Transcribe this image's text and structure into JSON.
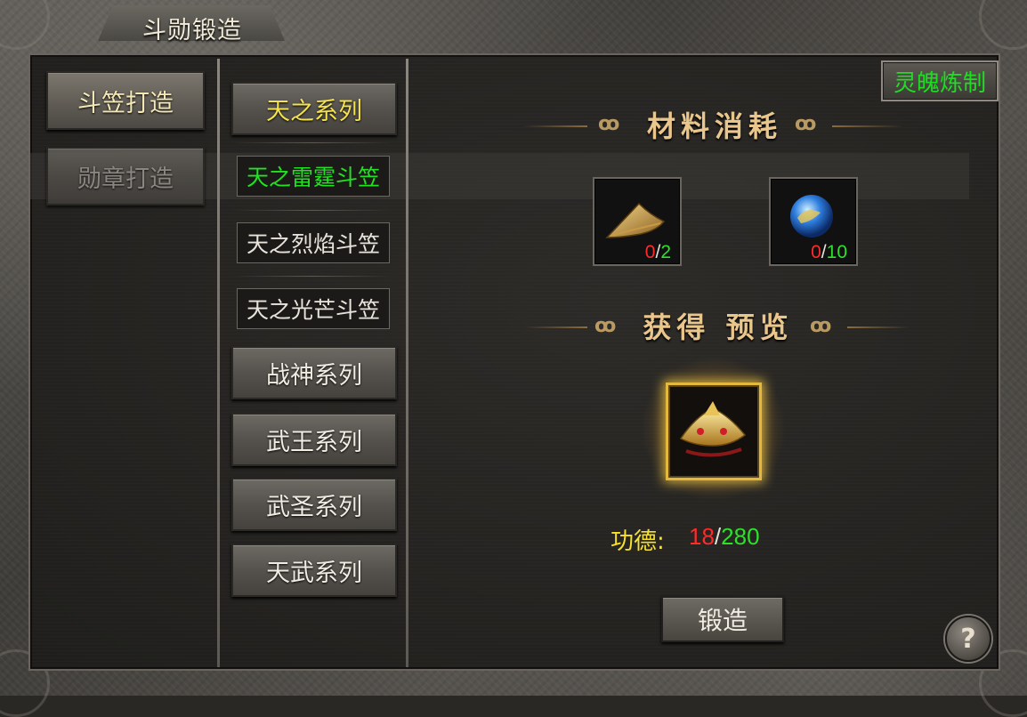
{
  "window": {
    "title": "斗勋锻造"
  },
  "categories": [
    {
      "label": "斗笠打造",
      "state": "active"
    },
    {
      "label": "勋章打造",
      "state": "dim"
    }
  ],
  "series_list": [
    {
      "label": "天之系列",
      "state": "active"
    },
    {
      "label": "战神系列"
    },
    {
      "label": "武王系列"
    },
    {
      "label": "武圣系列"
    },
    {
      "label": "天武系列"
    }
  ],
  "sub_items": [
    {
      "label": "天之雷霆斗笠",
      "state": "active"
    },
    {
      "label": "天之烈焰斗笠"
    },
    {
      "label": "天之光芒斗笠"
    }
  ],
  "spirit_button": {
    "label": "灵魄炼制"
  },
  "materials": {
    "title": "材料消耗",
    "slots": [
      {
        "icon": "bamboo-hat-icon",
        "have": "0",
        "sep": "/",
        "need": "2"
      },
      {
        "icon": "blue-orb-icon",
        "have": "0",
        "sep": "/",
        "need": "10"
      }
    ]
  },
  "preview": {
    "title": "获得 预览",
    "icon": "thunder-hat-icon"
  },
  "merit": {
    "label": "功德:",
    "have": "18",
    "sep": "/",
    "need": "280"
  },
  "forge_button": {
    "label": "锻造"
  },
  "help_button": {
    "label": "?"
  },
  "colors": {
    "active_green": "#2de12b",
    "shortage_red": "#ff2a2a",
    "gold_title": "#e9c68c",
    "merit_yellow": "#f7e12a"
  }
}
